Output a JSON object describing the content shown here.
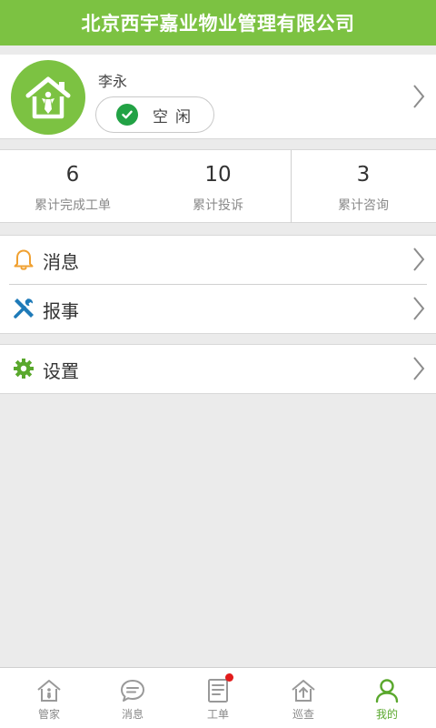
{
  "header": {
    "title": "北京西宇嘉业物业管理有限公司"
  },
  "profile": {
    "name": "李永",
    "status": "空闲"
  },
  "stats": [
    {
      "value": "6",
      "label": "累计完成工单"
    },
    {
      "value": "10",
      "label": "累计投诉"
    },
    {
      "value": "3",
      "label": "累计咨询"
    }
  ],
  "menu": {
    "messages": "消息",
    "report": "报事",
    "settings": "设置"
  },
  "tabs": [
    {
      "label": "管家",
      "icon": "house-icon"
    },
    {
      "label": "消息",
      "icon": "chat-icon"
    },
    {
      "label": "工单",
      "icon": "document-icon"
    },
    {
      "label": "巡查",
      "icon": "patrol-house-icon"
    },
    {
      "label": "我的",
      "icon": "user-icon"
    }
  ],
  "colors": {
    "brand_green": "#7cc242",
    "status_green": "#22a245",
    "badge_red": "#e21b1b",
    "background": "#ebebeb"
  }
}
